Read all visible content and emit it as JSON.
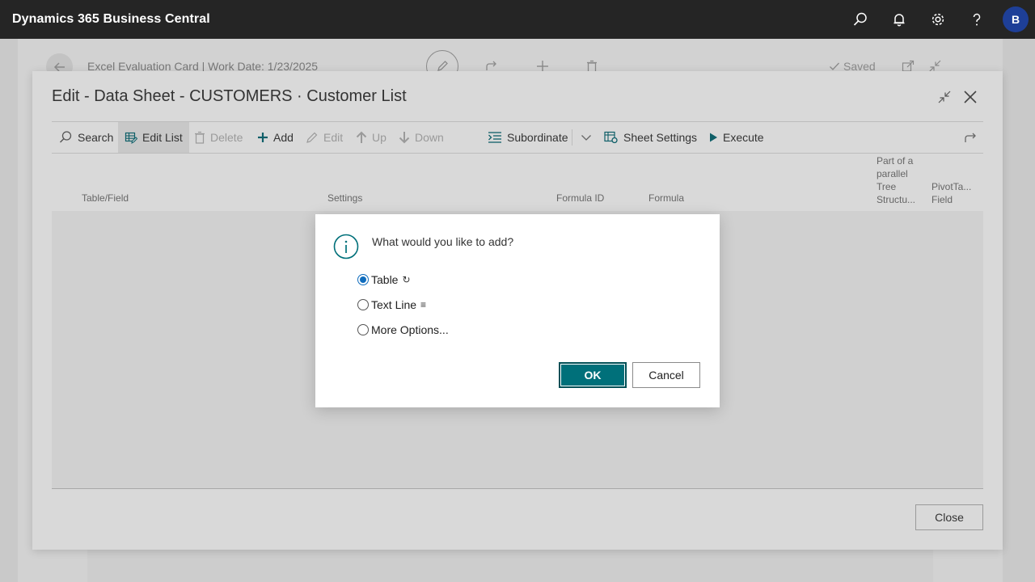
{
  "app": {
    "brand": "Dynamics 365 Business Central",
    "avatar_initial": "B"
  },
  "background_page": {
    "title": "Excel Evaluation Card | Work Date: 1/23/2025",
    "saved_label": "Saved"
  },
  "panel": {
    "title": "Edit - Data Sheet - CUSTOMERS · Customer List",
    "actions": {
      "search": "Search",
      "edit_list": "Edit List",
      "delete": "Delete",
      "add": "Add",
      "edit": "Edit",
      "up": "Up",
      "down": "Down",
      "subordinate": "Subordinate",
      "sheet_settings": "Sheet Settings",
      "execute": "Execute"
    },
    "columns": {
      "table_field": "Table/Field",
      "settings": "Settings",
      "formula_id": "Formula ID",
      "formula": "Formula",
      "parallel_1": "Part of a",
      "parallel_2": "parallel",
      "parallel_3": "Tree",
      "parallel_4": "Structu...",
      "pivot_1": "PivotTa...",
      "pivot_2": "Field"
    },
    "close_label": "Close"
  },
  "dialog": {
    "question": "What would you like to add?",
    "options": [
      {
        "label": "Table",
        "glyph": "↻",
        "selected": true
      },
      {
        "label": "Text Line",
        "glyph": "≡",
        "selected": false
      },
      {
        "label": "More Options...",
        "glyph": "",
        "selected": false
      }
    ],
    "ok_label": "OK",
    "cancel_label": "Cancel"
  },
  "colors": {
    "appbar": "#252525",
    "accent": "#00707a",
    "avatar": "#1e3f97",
    "radio": "#0f6cbd"
  }
}
